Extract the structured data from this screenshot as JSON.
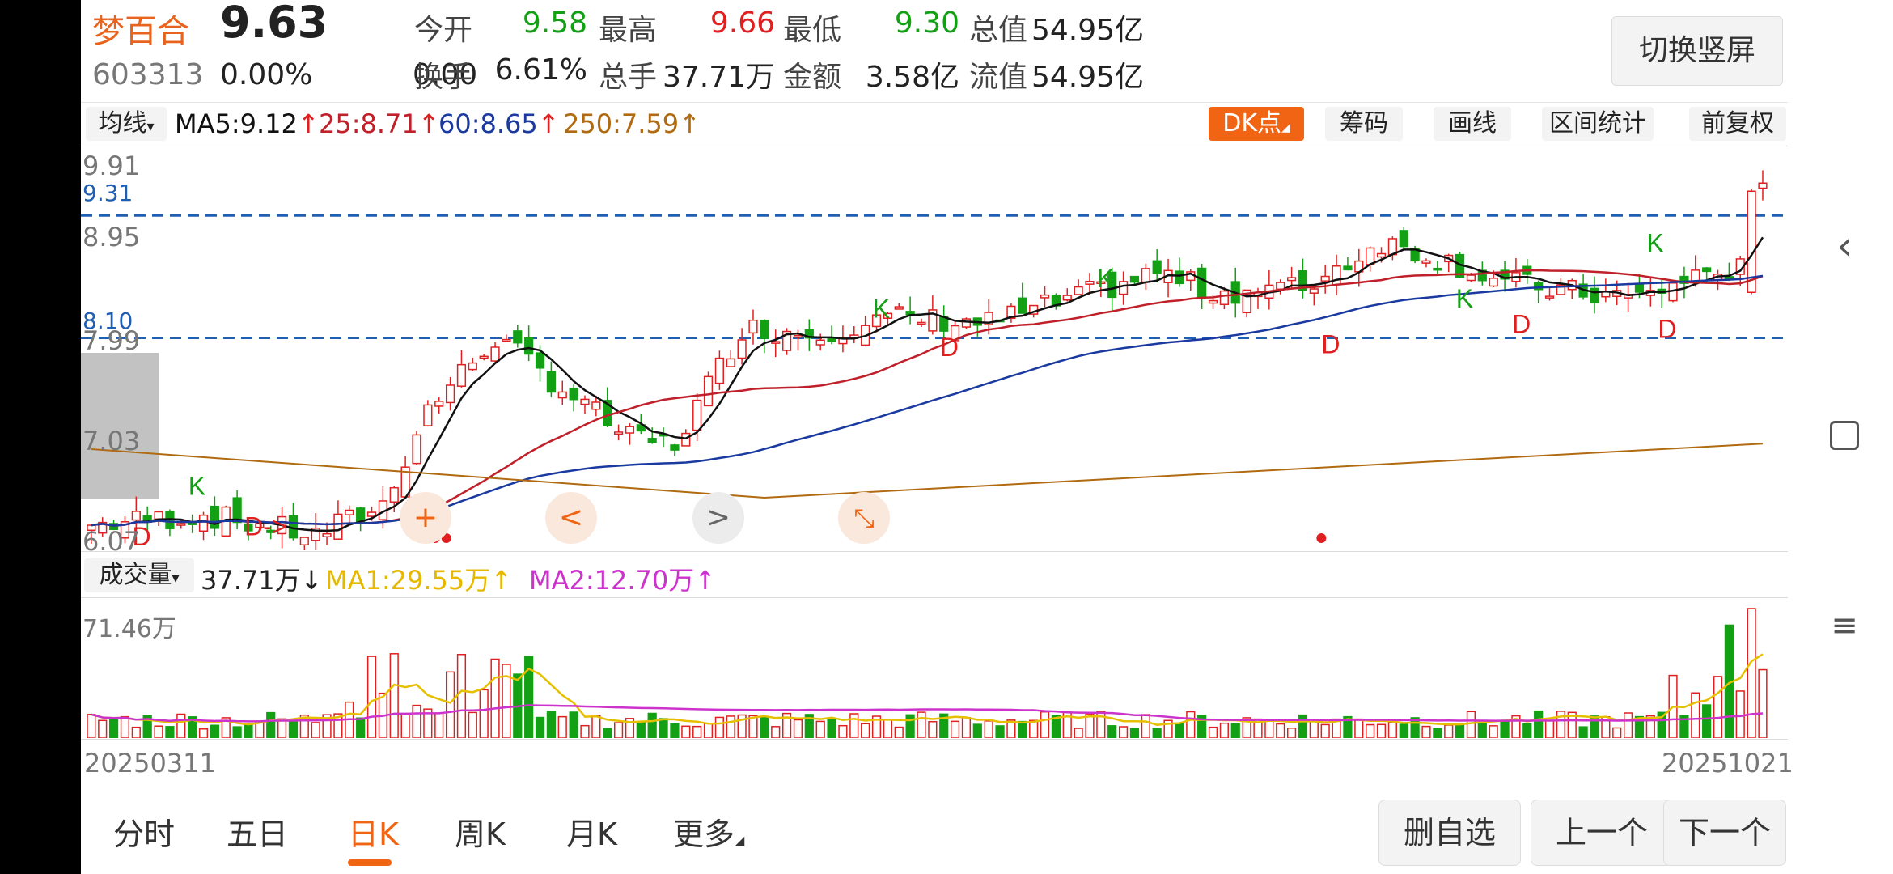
{
  "header": {
    "stock_name": "梦百合",
    "price": "9.63",
    "code": "603313",
    "change_pct": "0.00%",
    "change_amt": "0.00",
    "fields": [
      {
        "label": "今开",
        "value": "9.58",
        "color": "green"
      },
      {
        "label": "最高",
        "value": "9.66",
        "color": "red"
      },
      {
        "label": "最低",
        "value": "9.30",
        "color": "green"
      },
      {
        "label": "总值",
        "value": "54.95亿",
        "color": "dark"
      },
      {
        "label": "换手",
        "value": "6.61%",
        "color": "dark"
      },
      {
        "label": "总手",
        "value": "37.71万",
        "color": "dark"
      },
      {
        "label": "金额",
        "value": "3.58亿",
        "color": "dark"
      },
      {
        "label": "流值",
        "value": "54.95亿",
        "color": "dark"
      }
    ],
    "switch_button": "切换竖屏"
  },
  "ma_bar": {
    "selector": "均线",
    "ma5": "MA5:9.12",
    "ma25": "25:8.71",
    "ma60": "60:8.65",
    "ma250": "250:7.59",
    "up_arrow": "↑",
    "buttons": [
      "DK点",
      "筹码",
      "画线",
      "区间统计",
      "前复权"
    ]
  },
  "price_axis": {
    "labels": [
      "9.91",
      "9.31",
      "8.95",
      "8.10",
      "7.99",
      "7.03",
      "6.07"
    ],
    "dashed_levels": [
      9.31,
      8.1
    ]
  },
  "chart_overlay": {
    "plus_icon": "+",
    "left_icon": "<",
    "right_icon": ">",
    "collapse_icon": "⤡"
  },
  "volume_bar": {
    "selector": "成交量",
    "volume": "37.71万",
    "down_arrow": "↓",
    "ma1": "MA1:29.55万",
    "ma2": "MA2:12.70万",
    "up_arrow": "↑",
    "max_label": "71.46万"
  },
  "dates": {
    "start": "20250311",
    "end": "20251021"
  },
  "tabs": [
    "分时",
    "五日",
    "日K",
    "周K",
    "月K",
    "更多"
  ],
  "active_tab": "日K",
  "bottom_buttons": [
    "删自选",
    "上一个",
    "下一个"
  ],
  "chart_data": {
    "type": "candlestick",
    "ylim": [
      6.0,
      10.0
    ],
    "annotations": [
      {
        "text": "K"
      },
      {
        "text": "D"
      },
      {
        "text": "D->"
      },
      {
        "text": "K"
      },
      {
        "text": "D"
      },
      {
        "text": "K"
      },
      {
        "text": "D"
      },
      {
        "text": "K"
      },
      {
        "text": "D"
      },
      {
        "text": "K"
      },
      {
        "text": "D"
      }
    ]
  },
  "colors": {
    "up": "#e02020",
    "down": "#14a014",
    "ma5": "#111111",
    "ma25": "#c0202a",
    "ma60": "#1a3aa0",
    "ma250": "#b06a10",
    "vma1": "#e6c000",
    "vma2": "#cc33cc",
    "dashed": "#1e5fb4",
    "accent": "#f06414"
  }
}
